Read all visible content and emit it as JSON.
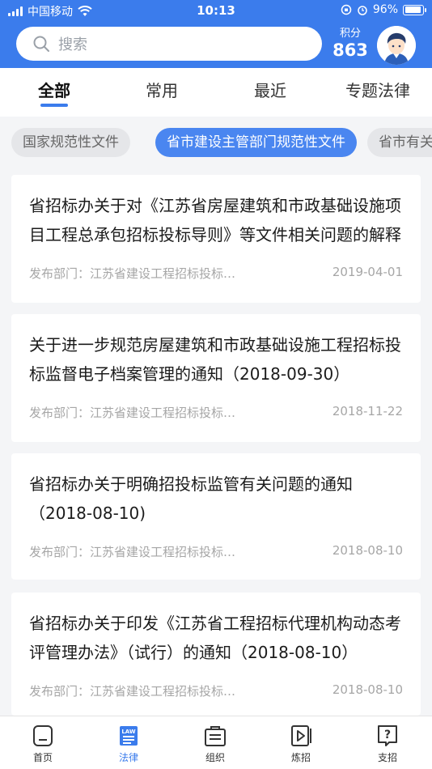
{
  "status_bar": {
    "carrier": "中国移动",
    "time": "10:13",
    "battery": "96%"
  },
  "search": {
    "placeholder": "搜索"
  },
  "points": {
    "label": "积分",
    "value": "863"
  },
  "tabs": [
    {
      "label": "全部",
      "active": true
    },
    {
      "label": "常用",
      "active": false
    },
    {
      "label": "最近",
      "active": false
    },
    {
      "label": "专题法律",
      "active": false
    }
  ],
  "chips": [
    {
      "label": "国家规范性文件",
      "active": false
    },
    {
      "label": "省市建设主管部门规范性文件",
      "active": true
    },
    {
      "label": "省市有关",
      "active": false
    }
  ],
  "articles": [
    {
      "title": "省招标办关于对《江苏省房屋建筑和市政基础设施项目工程总承包招标投标导则》等文件相关问题的解释",
      "dept": "发布部门：江苏省建设工程招标投标…",
      "date": "2019-04-01"
    },
    {
      "title": "关于进一步规范房屋建筑和市政基础设施工程招标投标监督电子档案管理的通知（2018-09-30）",
      "dept": "发布部门：江苏省建设工程招标投标…",
      "date": "2018-11-22"
    },
    {
      "title": "省招标办关于明确招投标监管有关问题的通知（2018-08-10)",
      "dept": "发布部门：江苏省建设工程招标投标…",
      "date": "2018-08-10"
    },
    {
      "title": "省招标办关于印发《江苏省工程招标代理机构动态考评管理办法》（试行）的通知（2018-08-10）",
      "dept": "发布部门：江苏省建设工程招标投标…",
      "date": "2018-08-10"
    }
  ],
  "bottom_nav": [
    {
      "label": "首页",
      "icon": "home-icon",
      "active": false
    },
    {
      "label": "法律",
      "icon": "law-icon",
      "active": true
    },
    {
      "label": "组织",
      "icon": "organization-icon",
      "active": false
    },
    {
      "label": "炼招",
      "icon": "video-play-icon",
      "active": false
    },
    {
      "label": "支招",
      "icon": "help-icon",
      "active": false
    }
  ],
  "colors": {
    "accent": "#3b7cec",
    "background": "#f4f5f7"
  }
}
